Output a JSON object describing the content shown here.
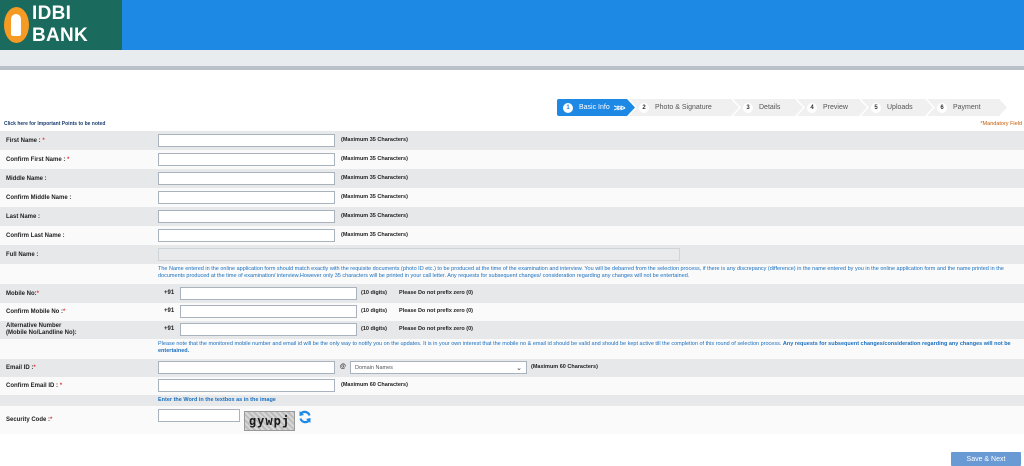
{
  "bank": {
    "name": "IDBI BANK"
  },
  "steps": [
    {
      "num": "1",
      "label": "Basic Info"
    },
    {
      "num": "2",
      "label": "Photo & Signature"
    },
    {
      "num": "3",
      "label": "Details"
    },
    {
      "num": "4",
      "label": "Preview"
    },
    {
      "num": "5",
      "label": "Uploads"
    },
    {
      "num": "6",
      "label": "Payment"
    }
  ],
  "important_link": "Click here for Important Points to be noted",
  "mandatory_note": "*Mandatory Field",
  "max35": "(Maximum 35 Characters)",
  "max60": "(Maximum 60 Characters)",
  "fields": {
    "first_name": "First Name :",
    "confirm_first_name": "Confirm First Name :",
    "middle_name": "Middle Name :",
    "confirm_middle_name": "Confirm Middle Name :",
    "last_name": "Last Name :",
    "confirm_last_name": "Confirm Last Name :",
    "full_name": "Full Name :",
    "mobile": "Mobile No:",
    "confirm_mobile": "Confirm Mobile No :",
    "alt_number_line1": "Alternative Number",
    "alt_number_line2": "(Mobile No/Landline No):",
    "email": "Email ID :",
    "confirm_email": "Confirm Email ID :",
    "security_code": "Security Code :"
  },
  "star": "*",
  "name_note": "The Name entered in the online application form should match exactly with the requisite documents (photo ID etc.) to be produced at the time of the examination and interview. You will be debarred from the selection process, if there is any discrepancy (difference) in the name entered by you in the online application form and the name printed in the documents produced at the time of examination/ interview.However only 35 characters will be printed in your call letter. Any requests for subsequent changes/ consideration regarding any changes will not be entertained.",
  "phone": {
    "prefix": "+91",
    "digits_hint": "(10 digits)",
    "zero_hint": "Please Do not prefix zero (0)"
  },
  "contact_note_normal": "Please note that the monitored mobile number and email id will be the only way to notify you on the updates. It is in your own interest that the mobile no & email id should be valid and should be kept active till the completion of this round of selection process.",
  "contact_note_bold": "Any requests for subsequent changes/consideration regarding any changes will not be entertained.",
  "email": {
    "at": "@",
    "domain_placeholder": "Domain Names"
  },
  "captcha": {
    "instruction": "Enter the Word in the textbox as in the image",
    "text": "gywpj"
  },
  "save_next": "Save & Next",
  "colors": {
    "header": "#1e88e5",
    "logo_bg": "#1b6a5e",
    "logo_orange": "#f59a23",
    "note_blue": "#1a6fbf",
    "button": "#6a9ad3"
  }
}
